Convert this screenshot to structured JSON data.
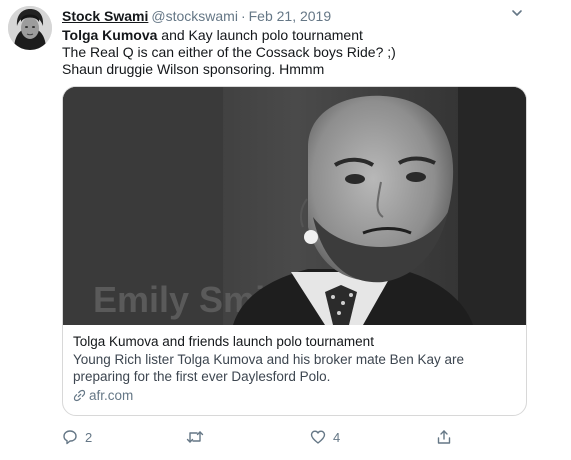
{
  "tweet": {
    "author": {
      "display_name": "Stock Swami",
      "handle": "@stockswami",
      "separator": "·",
      "date": "Feb 21, 2019"
    },
    "body": {
      "mention": "Tolga Kumova",
      "line1_rest": " and Kay launch polo tournament",
      "line2": "The Real Q is can either of the Cossack boys Ride? ;)",
      "line3": "Shaun druggie Wilson sponsoring. Hmmm"
    },
    "card": {
      "title": "Tolga Kumova and friends launch polo tournament",
      "description": "Young Rich lister Tolga Kumova and his broker mate Ben Kay are preparing for the first ever Daylesford Polo.",
      "domain": "afr.com",
      "image_description": "Black and white photo of a bald man with a beard wearing a suit and polka-dot tie, lapel microphone"
    },
    "actions": {
      "reply_count": "2",
      "retweet_count": "",
      "like_count": "4"
    },
    "colors": {
      "text": "#14171a",
      "secondary": "#657786",
      "border": "#d8d8d8"
    },
    "icons": [
      "avatar",
      "chevron-down-icon",
      "link-icon",
      "reply-icon",
      "retweet-icon",
      "like-icon",
      "share-icon"
    ]
  }
}
